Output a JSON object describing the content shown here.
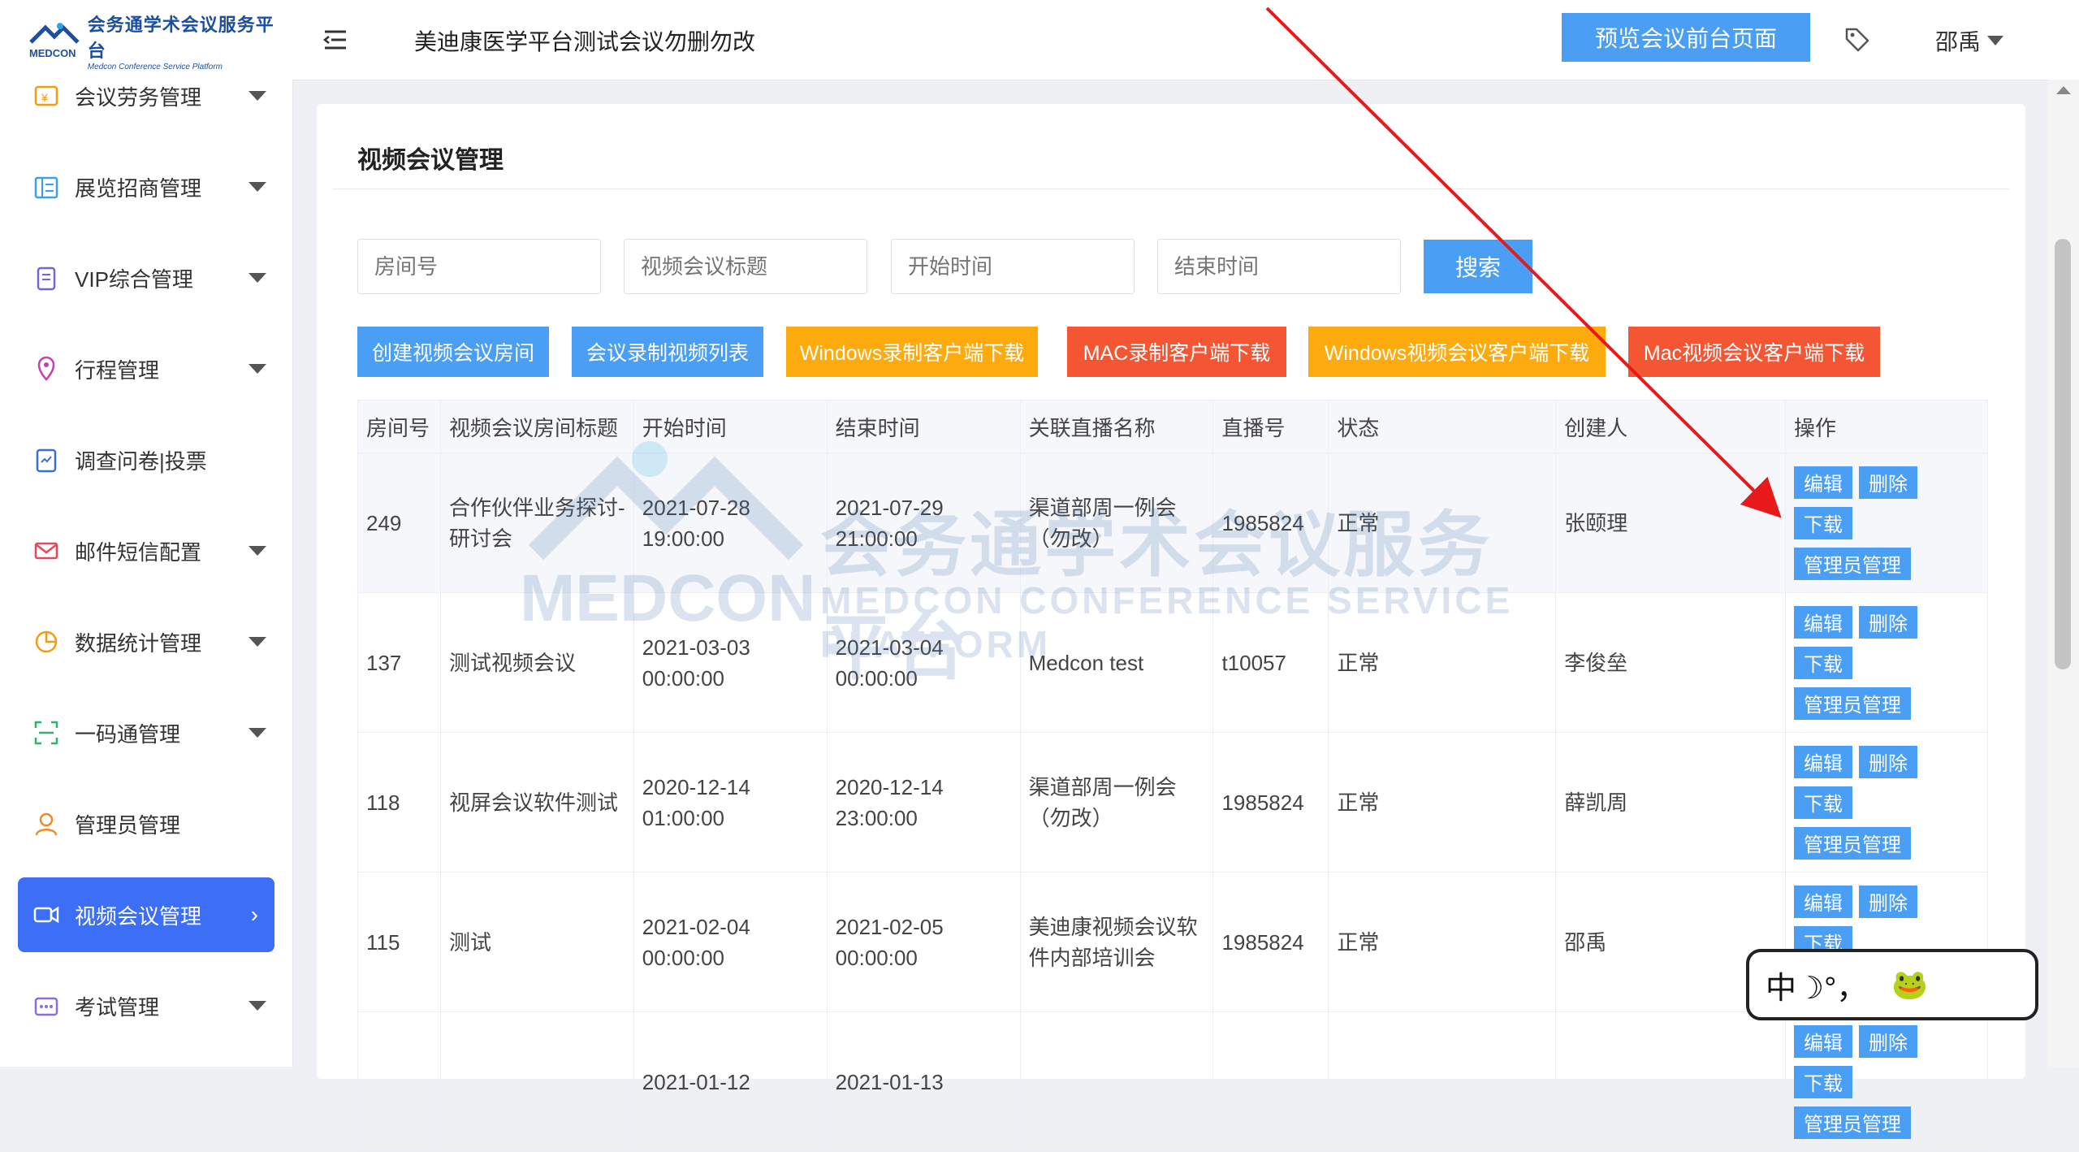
{
  "logo": {
    "cn": "会务通学术会议服务平台",
    "en": "Medcon Conference Service Platform",
    "mark": "MEDCON"
  },
  "header": {
    "title": "美迪康医学平台测试会议勿删勿改",
    "preview_btn": "预览会议前台页面",
    "user": "邵禹"
  },
  "sidebar": {
    "items": [
      {
        "label": "会议劳务管理",
        "icon": "money-icon",
        "caret": true
      },
      {
        "label": "展览招商管理",
        "icon": "exhibit-icon",
        "caret": true
      },
      {
        "label": "VIP综合管理",
        "icon": "vip-icon",
        "caret": true
      },
      {
        "label": "行程管理",
        "icon": "location-icon",
        "caret": true
      },
      {
        "label": "调查问卷|投票",
        "icon": "survey-icon",
        "caret": false
      },
      {
        "label": "邮件短信配置",
        "icon": "mail-icon",
        "caret": true
      },
      {
        "label": "数据统计管理",
        "icon": "pie-chart-icon",
        "caret": true
      },
      {
        "label": "一码通管理",
        "icon": "qr-scan-icon",
        "caret": true
      },
      {
        "label": "管理员管理",
        "icon": "user-icon",
        "caret": false
      },
      {
        "label": "视频会议管理",
        "icon": "video-icon",
        "caret": false,
        "active": true
      },
      {
        "label": "考试管理",
        "icon": "exam-icon",
        "caret": true
      }
    ]
  },
  "page": {
    "title": "视频会议管理"
  },
  "filters": {
    "room_placeholder": "房间号",
    "title_placeholder": "视频会议标题",
    "start_placeholder": "开始时间",
    "end_placeholder": "结束时间",
    "search_btn": "搜索"
  },
  "actions": [
    {
      "label": "创建视频会议房间",
      "color": "#4a9ff5"
    },
    {
      "label": "会议录制视频列表",
      "color": "#4a9ff5"
    },
    {
      "label": "Windows录制客户端下载",
      "color": "#fcaa0d"
    },
    {
      "label": "MAC录制客户端下载",
      "color": "#f45634"
    },
    {
      "label": "Windows视频会议客户端下载",
      "color": "#fcaa0d"
    },
    {
      "label": "Mac视频会议客户端下载",
      "color": "#f45634"
    }
  ],
  "table": {
    "headers": [
      "房间号",
      "视频会议房间标题",
      "开始时间",
      "结束时间",
      "关联直播名称",
      "直播号",
      "状态",
      "创建人",
      "操作"
    ],
    "rows": [
      {
        "room": "249",
        "title": "合作伙伴业务探讨-研讨会",
        "start": "2021-07-28 19:00:00",
        "end": "2021-07-29 21:00:00",
        "live_name": "渠道部周一例会（勿改）",
        "live_no": "1985824",
        "status": "正常",
        "creator": "张颐理"
      },
      {
        "room": "137",
        "title": "测试视频会议",
        "start": "2021-03-03 00:00:00",
        "end": "2021-03-04 00:00:00",
        "live_name": "Medcon test",
        "live_no": "t10057",
        "status": "正常",
        "creator": "李俊垒"
      },
      {
        "room": "118",
        "title": "视屏会议软件测试",
        "start": "2020-12-14 01:00:00",
        "end": "2020-12-14 23:00:00",
        "live_name": "渠道部周一例会（勿改）",
        "live_no": "1985824",
        "status": "正常",
        "creator": "薛凯周"
      },
      {
        "room": "115",
        "title": "测试",
        "start": "2021-02-04 00:00:00",
        "end": "2021-02-05 00:00:00",
        "live_name": "美迪康视频会议软件内部培训会",
        "live_no": "1985824",
        "status": "正常",
        "creator": "邵禹"
      },
      {
        "room": "",
        "title": "",
        "start": "2021-01-12",
        "end": "2021-01-13",
        "live_name": "",
        "live_no": "",
        "status": "",
        "creator": ""
      }
    ],
    "op_labels": {
      "edit": "编辑",
      "delete": "删除",
      "download": "下载",
      "admin": "管理员管理"
    }
  },
  "watermark": {
    "cn": "会务通学术会议服务平台",
    "en": "MEDCON CONFERENCE SERVICE PLATFORM",
    "logo": "MEDCON"
  },
  "ime": {
    "text": "中☽°，"
  }
}
